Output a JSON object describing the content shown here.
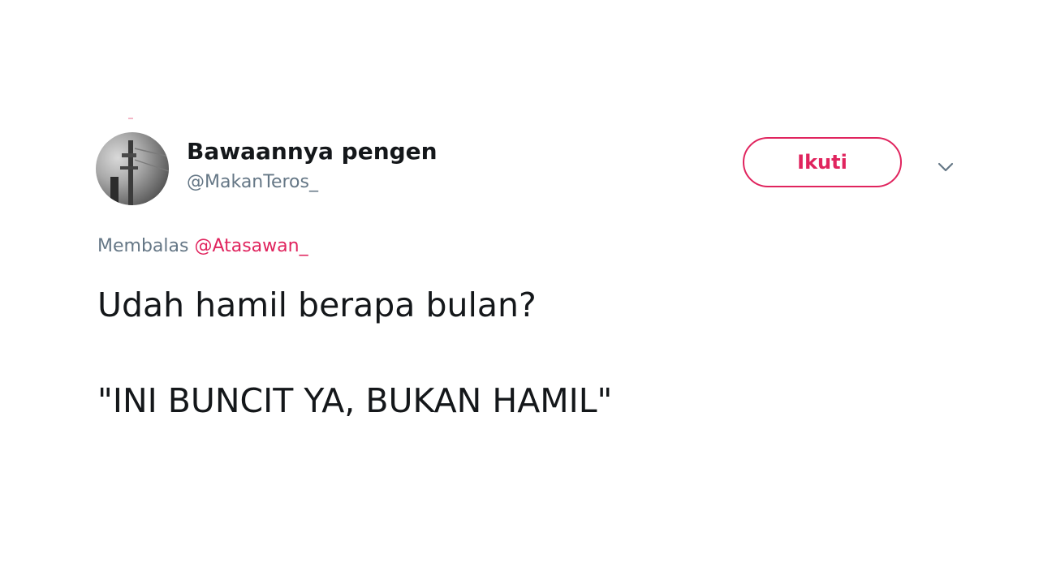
{
  "tweet": {
    "author": {
      "display_name": "Bawaannya pengen",
      "handle": "@MakanTeros_",
      "avatar_icon": "profile-avatar"
    },
    "follow_button_label": "Ikuti",
    "menu_icon": "chevron-down-icon",
    "reply": {
      "prefix": "Membalas",
      "mention": "@Atasawan_"
    },
    "text_lines": [
      "Udah hamil berapa bulan?",
      "\"INI BUNCIT YA, BUKAN HAMIL\""
    ]
  },
  "colors": {
    "accent": "#e0245e",
    "secondary_text": "#657786",
    "primary_text": "#14171a",
    "background": "#ffffff"
  }
}
